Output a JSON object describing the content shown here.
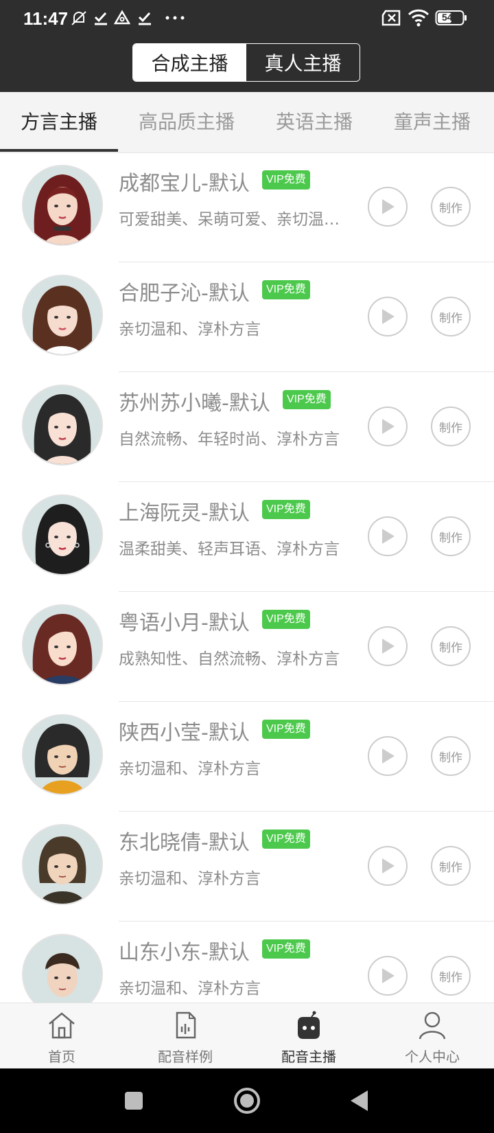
{
  "status_bar": {
    "time": "11:47",
    "battery": "54"
  },
  "header": {
    "segments": [
      "合成主播",
      "真人主播"
    ],
    "active_segment": 0
  },
  "category_tabs": [
    "方言主播",
    "高品质主播",
    "英语主播",
    "童声主播"
  ],
  "active_category": 0,
  "anchors": [
    {
      "name": "成都宝儿-默认",
      "badge": "VIP免费",
      "desc": "可爱甜美、呆萌可爱、亲切温和、淳朴方言"
    },
    {
      "name": "合肥子沁-默认",
      "badge": "VIP免费",
      "desc": "亲切温和、淳朴方言"
    },
    {
      "name": "苏州苏小曦-默认",
      "badge": "VIP免费",
      "desc": "自然流畅、年轻时尚、淳朴方言"
    },
    {
      "name": "上海阮灵-默认",
      "badge": "VIP免费",
      "desc": "温柔甜美、轻声耳语、淳朴方言"
    },
    {
      "name": "粤语小月-默认",
      "badge": "VIP免费",
      "desc": "成熟知性、自然流畅、淳朴方言"
    },
    {
      "name": "陕西小莹-默认",
      "badge": "VIP免费",
      "desc": "亲切温和、淳朴方言"
    },
    {
      "name": "东北晓倩-默认",
      "badge": "VIP免费",
      "desc": "亲切温和、淳朴方言"
    },
    {
      "name": "山东小东-默认",
      "badge": "VIP免费",
      "desc": "亲切温和、淳朴方言"
    }
  ],
  "make_label": "制作",
  "bottom_nav": [
    {
      "label": "首页",
      "icon": "home-icon"
    },
    {
      "label": "配音样例",
      "icon": "audio-file-icon"
    },
    {
      "label": "配音主播",
      "icon": "robot-anchor-icon"
    },
    {
      "label": "个人中心",
      "icon": "person-icon"
    }
  ],
  "active_nav": 2,
  "colors": {
    "header_bg": "#2e2e2e",
    "vip_green": "#4cc94c",
    "tab_bg": "#f4f4f4"
  }
}
